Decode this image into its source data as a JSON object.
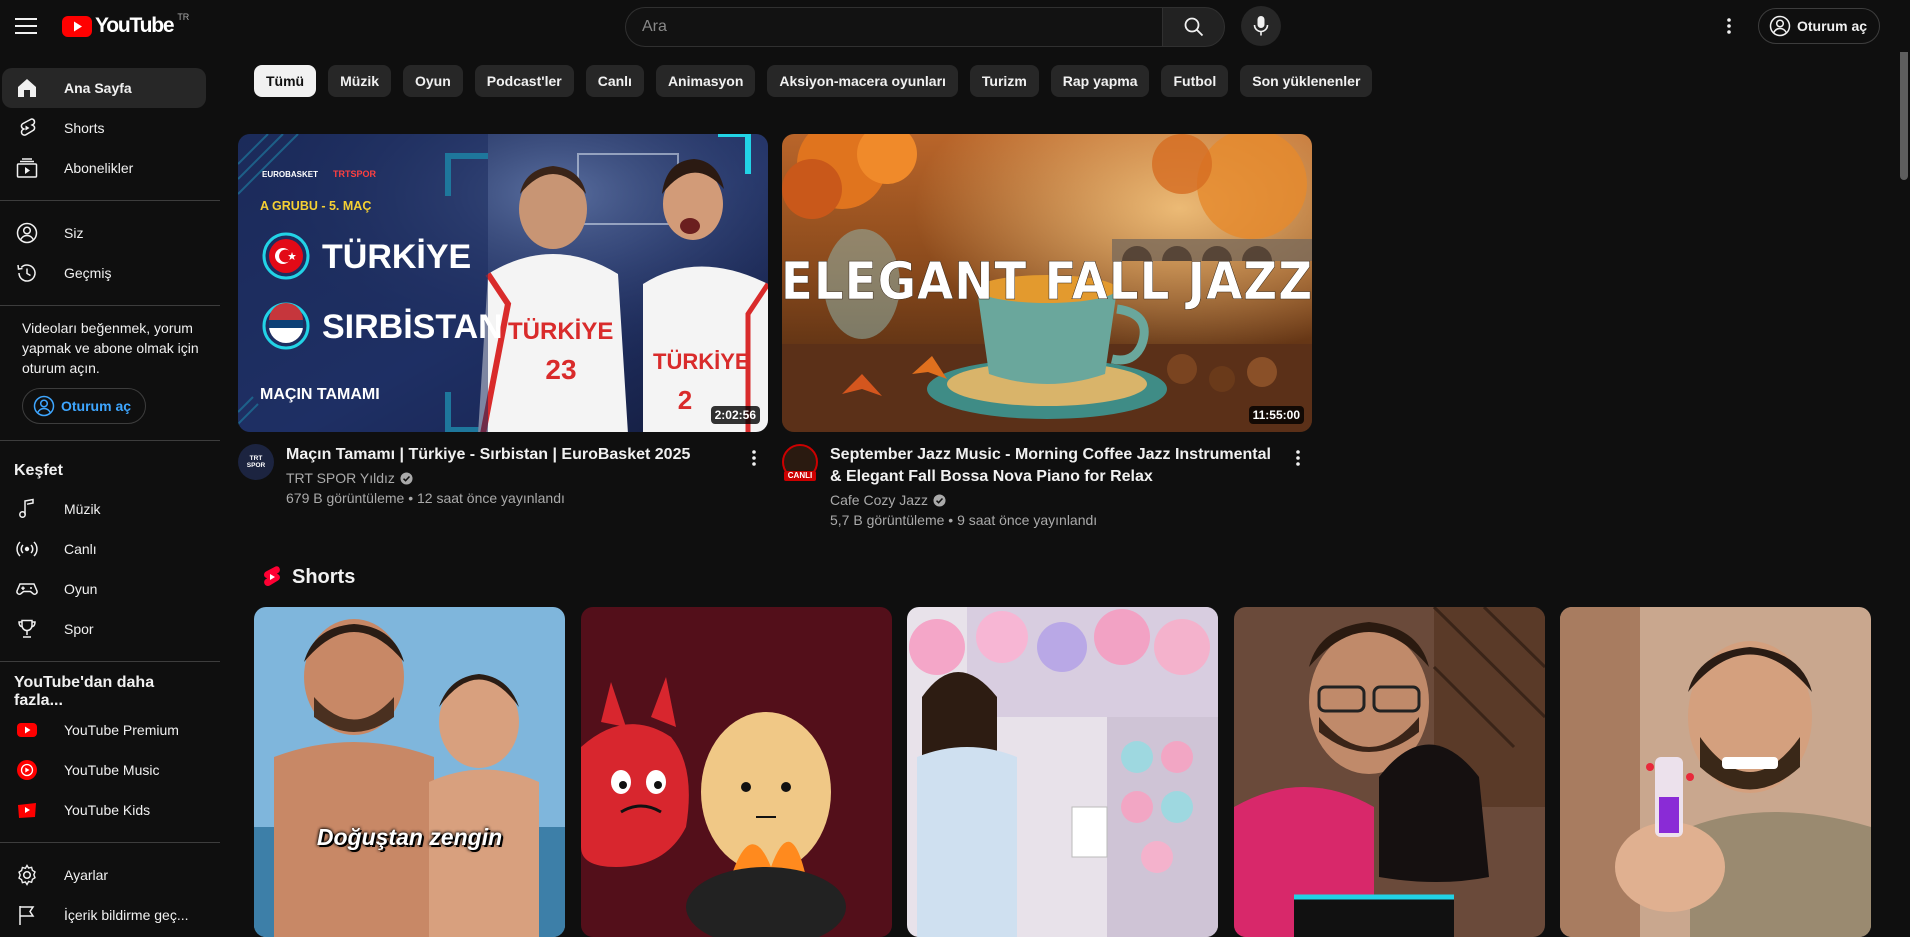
{
  "header": {
    "logo_text": "YouTube",
    "country_code": "TR",
    "search_placeholder": "Ara",
    "signin_label": "Oturum aç"
  },
  "sidebar": {
    "main": [
      {
        "label": "Ana Sayfa",
        "icon": "home-icon"
      },
      {
        "label": "Shorts",
        "icon": "shorts-icon"
      },
      {
        "label": "Abonelikler",
        "icon": "subscriptions-icon"
      }
    ],
    "you": [
      {
        "label": "Siz",
        "icon": "user-icon"
      },
      {
        "label": "Geçmiş",
        "icon": "history-icon"
      }
    ],
    "signin_note": "Videoları beğenmek, yorum yapmak ve abone olmak için oturum açın.",
    "signin_label": "Oturum aç",
    "explore_heading": "Keşfet",
    "explore": [
      {
        "label": "Müzik",
        "icon": "music-icon"
      },
      {
        "label": "Canlı",
        "icon": "live-icon"
      },
      {
        "label": "Oyun",
        "icon": "gaming-icon"
      },
      {
        "label": "Spor",
        "icon": "trophy-icon"
      }
    ],
    "more_heading": "YouTube'dan daha fazla...",
    "more": [
      {
        "label": "YouTube Premium"
      },
      {
        "label": "YouTube Music"
      },
      {
        "label": "YouTube Kids"
      }
    ],
    "settings": [
      {
        "label": "Ayarlar",
        "icon": "gear-icon"
      },
      {
        "label": "İçerik bildirme geç...",
        "icon": "flag-icon"
      }
    ]
  },
  "chips": [
    "Tümü",
    "Müzik",
    "Oyun",
    "Podcast'ler",
    "Canlı",
    "Animasyon",
    "Aksiyon-macera oyunları",
    "Turizm",
    "Rap yapma",
    "Futbol",
    "Son yüklenenler"
  ],
  "videos": [
    {
      "title": "Maçın Tamamı | Türkiye - Sırbistan | EuroBasket 2025",
      "channel": "TRT SPOR Yıldız",
      "stats": "679 B görüntüleme • 12 saat önce yayınlandı",
      "duration": "2:02:56",
      "thumb_text": {
        "brand1": "EUROBASKET",
        "brand2": "TRTSPOR",
        "group": "A GRUBU - 5. MAÇ",
        "team1": "TÜRKİYE",
        "team2": "SIRBİSTAN",
        "footer": "MAÇIN TAMAMI",
        "jersey1_name": "TÜRKİYE",
        "jersey1_number": "23",
        "jersey2_name": "TÜRKİYE",
        "jersey2_number": "2"
      },
      "avatar_text": "TRT SPOR"
    },
    {
      "title": "September Jazz Music - Morning Coffee Jazz Instrumental & Elegant Fall Bossa Nova Piano for Relax",
      "channel": "Cafe Cozy Jazz",
      "stats": "5,7 B görüntüleme • 9 saat önce yayınlandı",
      "duration": "11:55:00",
      "thumb_text": {
        "headline": "ELEGANT FALL JAZZ"
      },
      "avatar_badge": "CANLI"
    }
  ],
  "shorts": {
    "title": "Shorts",
    "items": [
      {
        "caption": "Doğuştan zengin"
      },
      {
        "caption": ""
      },
      {
        "caption": ""
      },
      {
        "caption": ""
      },
      {
        "caption": ""
      }
    ]
  },
  "colors": {
    "background": "#0f0f0f",
    "brand_red": "#ff0000",
    "link_blue": "#3ea6ff",
    "chip_bg": "#272727"
  }
}
